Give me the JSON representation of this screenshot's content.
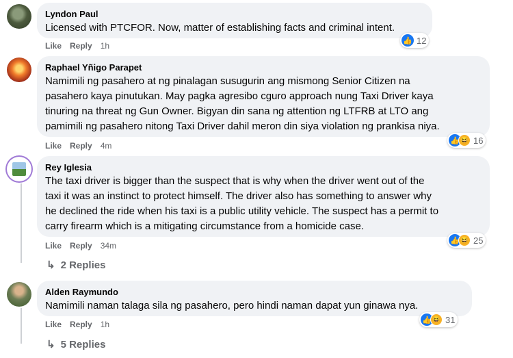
{
  "comments": [
    {
      "author": "Lyndon Paul",
      "lines": [
        "Licensed with PTCFOR. Now, matter of establishing facts and criminal intent."
      ],
      "like": "Like",
      "reply": "Reply",
      "time": "1h",
      "reaction_count": "12",
      "reactions": [
        "like-icon"
      ]
    },
    {
      "author": "Raphael Yñigo Parapet",
      "lines": [
        "Namimili ng pasahero at ng pinalagan susugurin ang mismong Senior Citizen na",
        "pasahero kaya pinutukan. May pagka agresibo cguro approach nung Taxi Driver kaya",
        "tinuring na threat ng Gun Owner. Bigyan din sana ng attention ng LTFRB at LTO ang",
        "pamimili ng pasahero nitong Taxi Driver dahil meron din siya violation ng prankisa niya."
      ],
      "like": "Like",
      "reply": "Reply",
      "time": "4m",
      "reaction_count": "16",
      "reactions": [
        "like-icon",
        "haha-icon"
      ]
    },
    {
      "author": "Rey Iglesia",
      "lines": [
        "The taxi driver is bigger than the suspect that is why when the driver went out of the",
        "taxi it was an instinct to protect himself. The driver also has something to answer why",
        "he declined the ride when his taxi is a public utility vehicle. The suspect has a permit to",
        "carry firearm which is a mitigating circumstance from a homicide case."
      ],
      "like": "Like",
      "reply": "Reply",
      "time": "34m",
      "reaction_count": "25",
      "reactions": [
        "like-icon",
        "haha-icon"
      ],
      "replies_link": "2 Replies"
    },
    {
      "author": "Alden Raymundo",
      "lines": [
        "Namimili naman talaga sila ng pasahero, pero hindi naman dapat yun ginawa nya."
      ],
      "like": "Like",
      "reply": "Reply",
      "time": "1h",
      "reaction_count": "31",
      "reactions": [
        "like-icon",
        "haha-icon"
      ],
      "replies_link": "5 Replies"
    }
  ],
  "icons": {
    "like": "👍",
    "haha": "😆",
    "reply_arrow": "↳"
  }
}
